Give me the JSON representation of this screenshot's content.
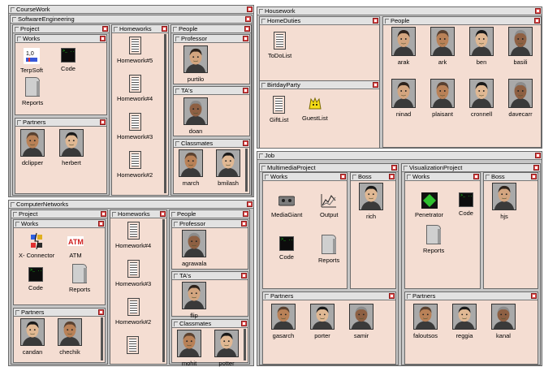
{
  "coursework": {
    "title": "CourseWork",
    "software_engineering": {
      "title": "SoftwareEngineering",
      "project": {
        "title": "Project",
        "works": {
          "title": "Works",
          "items": [
            "TerpSoft",
            "Code",
            "Reports"
          ]
        },
        "partners": {
          "title": "Partners",
          "items": [
            "dclipper",
            "herbert"
          ]
        }
      },
      "homeworks": {
        "title": "Homeworks",
        "items": [
          "Homework#5",
          "Homework#4",
          "Homework#3",
          "Homework#2"
        ]
      },
      "people": {
        "title": "People",
        "professor": {
          "title": "Professor",
          "items": [
            "purtilo"
          ]
        },
        "tas": {
          "title": "TA's",
          "items": [
            "doan"
          ]
        },
        "classmates": {
          "title": "Classmates",
          "items": [
            "march",
            "bmilash"
          ]
        }
      }
    },
    "computer_networks": {
      "title": "ComputerNetworks",
      "project": {
        "title": "Project",
        "works": {
          "title": "Works",
          "items": [
            "X- Connector",
            "ATM",
            "Code",
            "Reports"
          ]
        },
        "partners": {
          "title": "Partners",
          "items": [
            "candan",
            "chechik"
          ]
        }
      },
      "homeworks": {
        "title": "Homeworks",
        "items": [
          "Homework#4",
          "Homework#3",
          "Homework#2"
        ]
      },
      "people": {
        "title": "People",
        "professor": {
          "title": "Professor",
          "items": [
            "agrawala"
          ]
        },
        "tas": {
          "title": "TA's",
          "items": [
            "flip"
          ]
        },
        "classmates": {
          "title": "Classmates",
          "items": [
            "mohit",
            "potter"
          ]
        }
      }
    }
  },
  "housework": {
    "title": "Housework",
    "home_duties": {
      "title": "HomeDuties",
      "items": [
        "ToDoList"
      ]
    },
    "birthday_party": {
      "title": "BirtdayParty",
      "items": [
        "GiftList",
        "GuestList"
      ]
    },
    "people": {
      "title": "People",
      "items": [
        "arak",
        "ark",
        "ben",
        "basili",
        "ninad",
        "plaisant",
        "cronnell",
        "davecarr"
      ]
    }
  },
  "job": {
    "title": "Job",
    "multimedia": {
      "title": "MultimediaProject",
      "works": {
        "title": "Works",
        "items": [
          "MediaGiant",
          "Output",
          "Code",
          "Reports"
        ]
      },
      "boss": {
        "title": "Boss",
        "items": [
          "rich"
        ]
      },
      "partners": {
        "title": "Partners",
        "items": [
          "gasarch",
          "porter",
          "samir"
        ]
      }
    },
    "visualization": {
      "title": "VisualizationProject",
      "works": {
        "title": "Works",
        "items": [
          "Penetrator",
          "Code",
          "Reports"
        ]
      },
      "boss": {
        "title": "Boss",
        "items": [
          "hjs"
        ]
      },
      "partners": {
        "title": "Partners",
        "items": [
          "faloutsos",
          "reggia",
          "kanal"
        ]
      }
    }
  },
  "colors": {
    "panel": "#c6c6c6",
    "leaf": "#f4ddd2",
    "close": "#e25151",
    "terminal": "#19e019"
  }
}
